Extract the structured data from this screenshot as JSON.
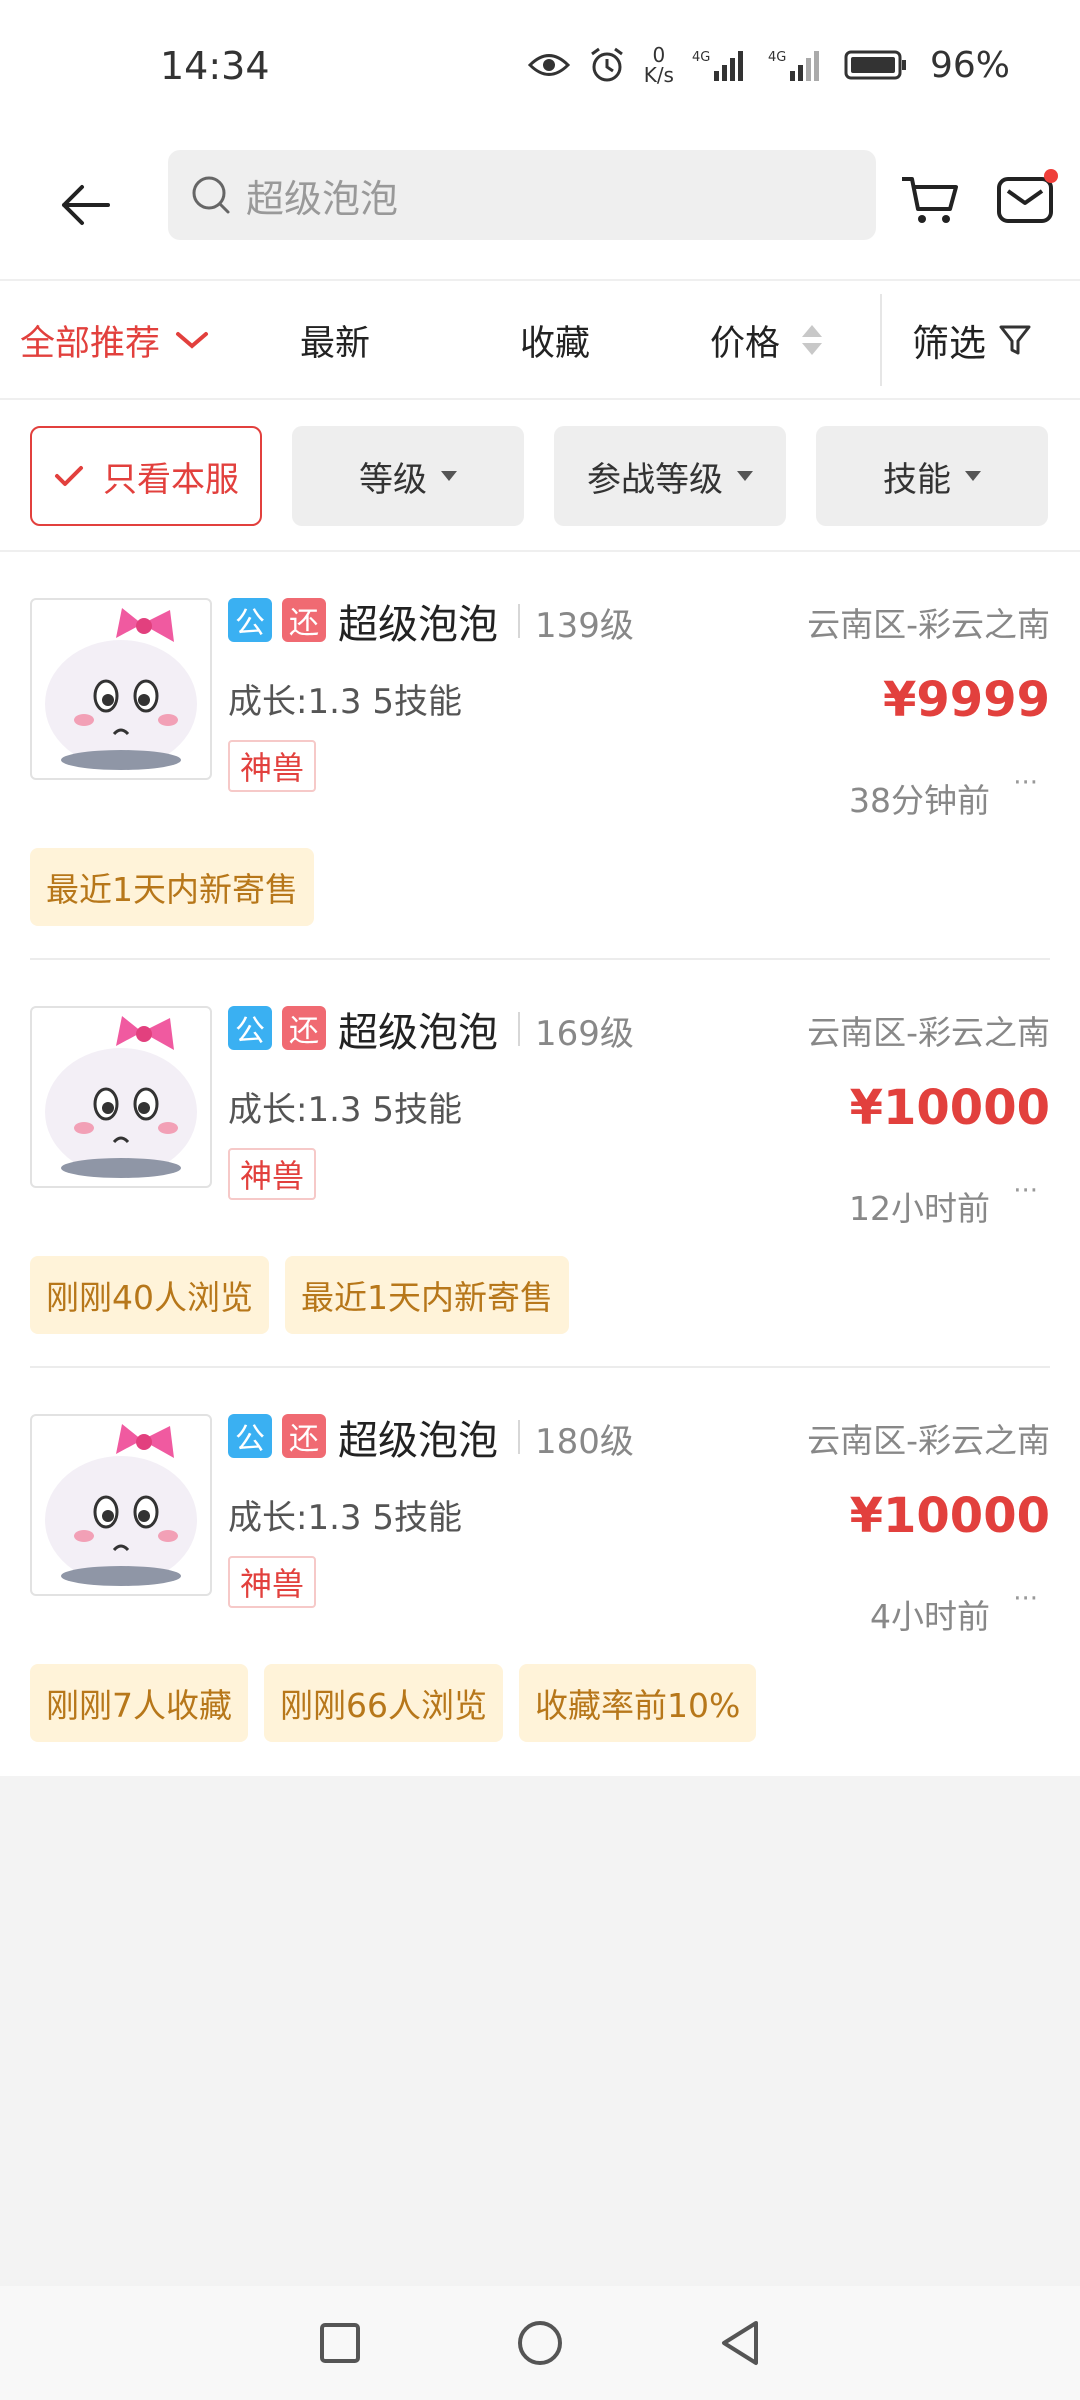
{
  "status_bar": {
    "time": "14:34",
    "net_speed_value": "0",
    "net_speed_unit": "K/s",
    "signal1_label": "4G",
    "signal2_label": "4G",
    "battery": "96%",
    "icons": [
      "eye-icon",
      "alarm-icon",
      "signal-icon",
      "battery-icon"
    ]
  },
  "header": {
    "search_placeholder": "超级泡泡",
    "icons": [
      "back-arrow-icon",
      "search-icon",
      "cart-icon",
      "mail-icon"
    ]
  },
  "sort_tabs": {
    "all": "全部推荐",
    "newest": "最新",
    "favorite": "收藏",
    "price": "价格",
    "filter": "筛选"
  },
  "filter_chips": {
    "server_only": "只看本服",
    "level": "等级",
    "battle_level": "参战等级",
    "skill": "技能"
  },
  "listings": [
    {
      "badge_public": "公",
      "badge_return": "还",
      "name": "超级泡泡",
      "level": "139级",
      "server": "云南区-彩云之南",
      "stats": "成长:1.3 5技能",
      "price": "¥9999",
      "tag": "神兽",
      "time": "38分钟前",
      "more": "···",
      "hints": [
        "最近1天内新寄售"
      ]
    },
    {
      "badge_public": "公",
      "badge_return": "还",
      "name": "超级泡泡",
      "level": "169级",
      "server": "云南区-彩云之南",
      "stats": "成长:1.3 5技能",
      "price": "¥10000",
      "tag": "神兽",
      "time": "12小时前",
      "more": "···",
      "hints": [
        "刚刚40人浏览",
        "最近1天内新寄售"
      ]
    },
    {
      "badge_public": "公",
      "badge_return": "还",
      "name": "超级泡泡",
      "level": "180级",
      "server": "云南区-彩云之南",
      "stats": "成长:1.3 5技能",
      "price": "¥10000",
      "tag": "神兽",
      "time": "4小时前",
      "more": "···",
      "hints": [
        "刚刚7人收藏",
        "刚刚66人浏览",
        "收藏率前10%"
      ]
    }
  ],
  "colors": {
    "accent": "#e2403d",
    "badge_public": "#3ab0f2",
    "badge_return": "#f06a72",
    "hint_bg": "#fff3d9",
    "hint_text": "#b7771a"
  }
}
